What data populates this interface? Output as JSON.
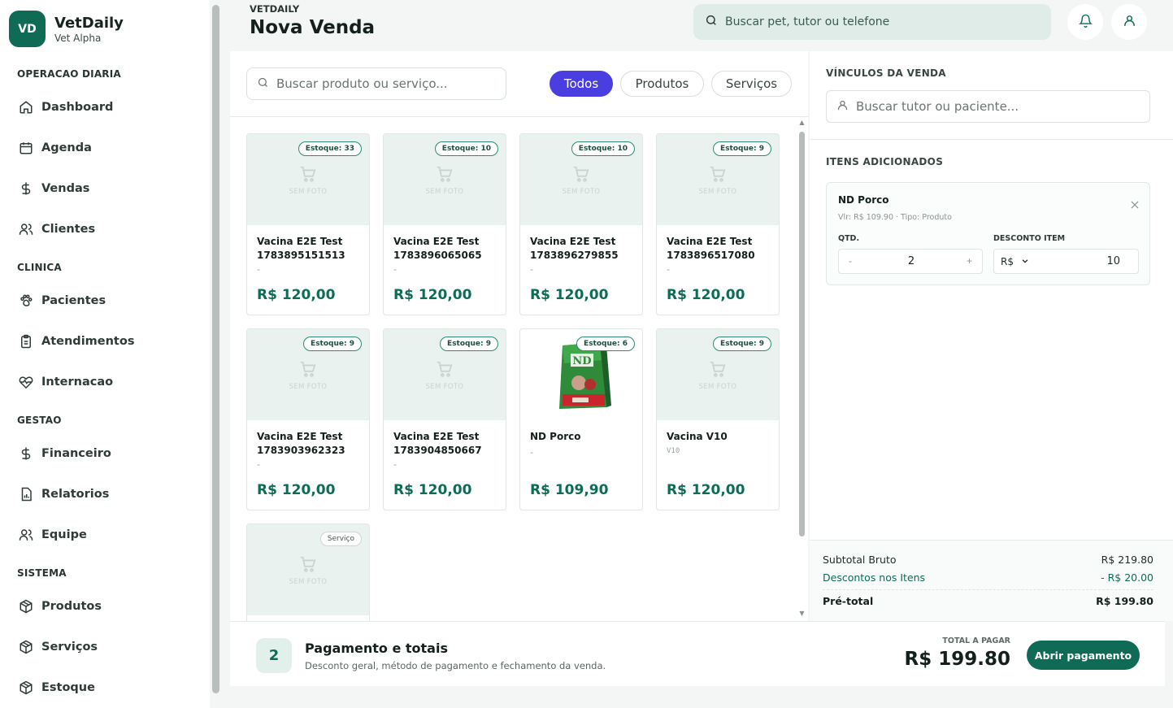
{
  "brand": {
    "logo": "VD",
    "name": "VetDaily",
    "sub": "Vet Alpha"
  },
  "sidebar": {
    "sections": [
      {
        "title": "OPERACAO DIARIA",
        "items": [
          {
            "label": "Dashboard",
            "icon": "home-icon"
          },
          {
            "label": "Agenda",
            "icon": "calendar-icon"
          },
          {
            "label": "Vendas",
            "icon": "dollar-icon"
          },
          {
            "label": "Clientes",
            "icon": "users-icon"
          }
        ]
      },
      {
        "title": "CLINICA",
        "items": [
          {
            "label": "Pacientes",
            "icon": "paw-icon"
          },
          {
            "label": "Atendimentos",
            "icon": "clipboard-icon"
          },
          {
            "label": "Internacao",
            "icon": "heart-pulse-icon"
          }
        ]
      },
      {
        "title": "GESTAO",
        "items": [
          {
            "label": "Financeiro",
            "icon": "dollar-icon"
          },
          {
            "label": "Relatorios",
            "icon": "report-icon"
          },
          {
            "label": "Equipe",
            "icon": "users-icon"
          }
        ]
      },
      {
        "title": "SISTEMA",
        "items": [
          {
            "label": "Produtos",
            "icon": "box-icon"
          },
          {
            "label": "Serviços",
            "icon": "box-icon"
          },
          {
            "label": "Estoque",
            "icon": "box-icon"
          }
        ]
      }
    ]
  },
  "header": {
    "sub": "VETDAILY",
    "title": "Nova Venda",
    "search_placeholder": "Buscar pet, tutor ou telefone"
  },
  "products": {
    "search_placeholder": "Buscar produto ou serviço...",
    "filters": [
      "Todos",
      "Produtos",
      "Serviços"
    ],
    "active_filter": "Todos",
    "no_photo_label": "SEM FOTO",
    "cards": [
      {
        "badge": "Estoque: 33",
        "name": "Vacina E2E Test 1783895151513",
        "desc": "-",
        "price": "R$ 120,00"
      },
      {
        "badge": "Estoque: 10",
        "name": "Vacina E2E Test 1783896065065",
        "desc": "-",
        "price": "R$ 120,00"
      },
      {
        "badge": "Estoque: 10",
        "name": "Vacina E2E Test 1783896279855",
        "desc": "-",
        "price": "R$ 120,00"
      },
      {
        "badge": "Estoque: 9",
        "name": "Vacina E2E Test 1783896517080",
        "desc": "-",
        "price": "R$ 120,00"
      },
      {
        "badge": "Estoque: 9",
        "name": "Vacina E2E Test 1783903962323",
        "desc": "-",
        "price": "R$ 120,00"
      },
      {
        "badge": "Estoque: 9",
        "name": "Vacina E2E Test 1783904850667",
        "desc": "-",
        "price": "R$ 120,00"
      },
      {
        "badge": "Estoque: 6",
        "name": "ND Porco",
        "desc": "-",
        "price": "R$ 109,90",
        "has_photo": true
      },
      {
        "badge": "Estoque: 9",
        "name": "Vacina V10",
        "desc": "V10",
        "price": "R$ 120,00"
      },
      {
        "badge": "Serviço",
        "name": "",
        "desc": "",
        "price": ""
      }
    ]
  },
  "links": {
    "title": "VÍNCULOS DA VENDA",
    "search_placeholder": "Buscar tutor ou paciente..."
  },
  "items": {
    "title": "ITENS ADICIONADOS",
    "list": [
      {
        "name": "ND Porco",
        "meta": "Vlr: R$ 109.90 · Tipo: Produto",
        "qty_label": "QTD.",
        "qty_minus": "-",
        "qty": "2",
        "qty_plus": "+",
        "discount_label": "DESCONTO ITEM",
        "discount_type": "R$",
        "discount_value": "10"
      }
    ]
  },
  "totals": {
    "subtotal_label": "Subtotal Bruto",
    "subtotal_value": "R$ 219.80",
    "discount_label": "Descontos nos Itens",
    "discount_value": "- R$ 20.00",
    "pretotal_label": "Pré-total",
    "pretotal_value": "R$ 199.80"
  },
  "footer": {
    "step": "2",
    "title": "Pagamento e totais",
    "sub": "Desconto geral, método de pagamento e fechamento da venda.",
    "total_label": "TOTAL A PAGAR",
    "total_value": "R$ 199.80",
    "pay_button": "Abrir pagamento"
  },
  "colors": {
    "brand": "#0f6b56",
    "accent": "#4b3ee0",
    "search_bg": "#dfece8"
  }
}
